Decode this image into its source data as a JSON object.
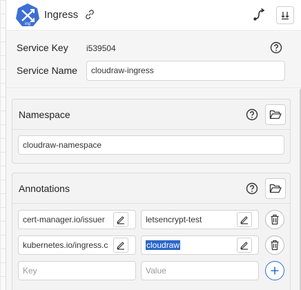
{
  "header": {
    "title": "Ingress",
    "logo_label": "ing"
  },
  "service": {
    "key_label": "Service Key",
    "key_value": "i539504",
    "name_label": "Service Name",
    "name_value": "cloudraw-ingress"
  },
  "namespace": {
    "title": "Namespace",
    "value": "cloudraw-namespace"
  },
  "annotations": {
    "title": "Annotations",
    "rows": [
      {
        "key": "cert-manager.io/issuer",
        "value": "letsencrypt-test"
      },
      {
        "key": "kubernetes.io/ingress.c",
        "value": "cloudraw"
      }
    ],
    "new_key_placeholder": "Key",
    "new_value_placeholder": "Value"
  },
  "colors": {
    "brand": "#3d6fd4",
    "accent": "#2a6fd6",
    "selection": "#2a66c9"
  }
}
